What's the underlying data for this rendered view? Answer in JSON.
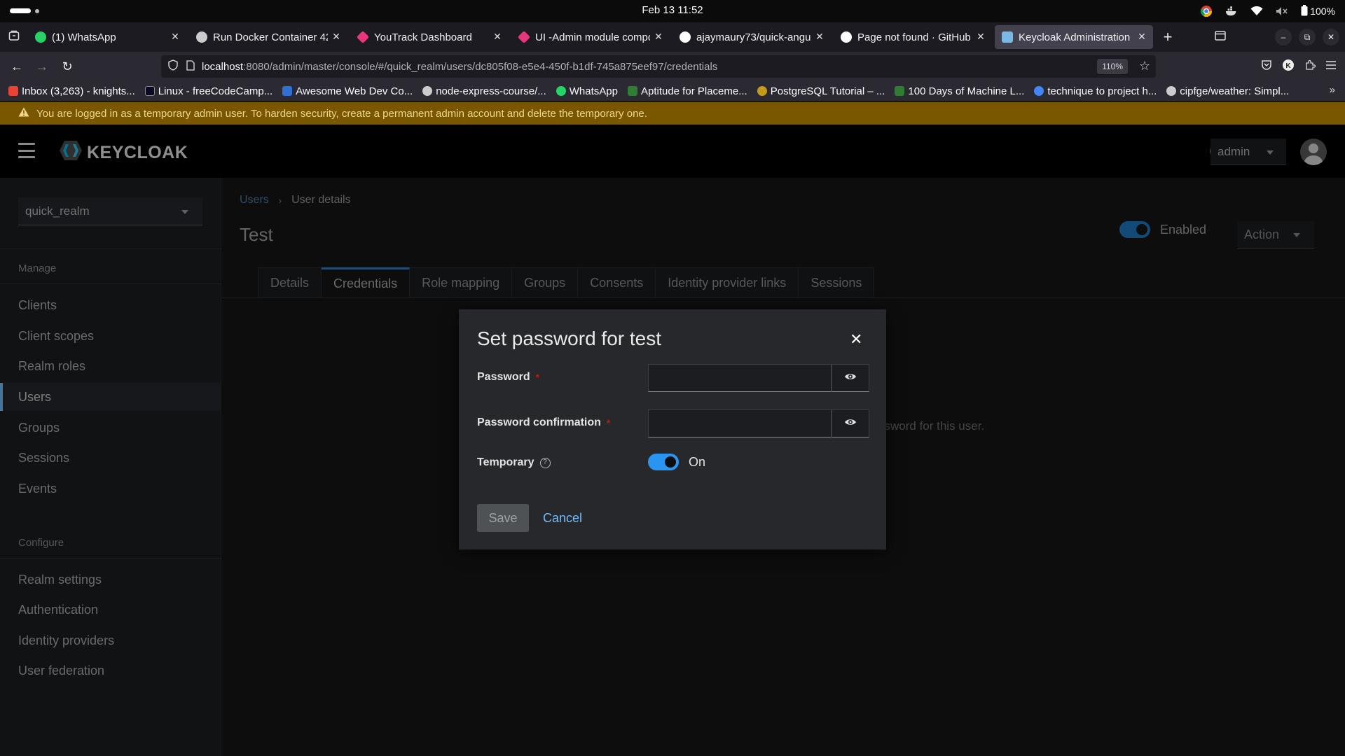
{
  "system": {
    "clock": "Feb 13  11:52",
    "battery": "100%"
  },
  "browser": {
    "tabs": [
      {
        "label": "(1) WhatsApp",
        "favicon_color": "#25d366"
      },
      {
        "label": "Run Docker Container 42",
        "favicon_color": "#cccccc"
      },
      {
        "label": "YouTrack Dashboard",
        "favicon_color": "#e8357e"
      },
      {
        "label": "UI -Admin module compo",
        "favicon_color": "#e8357e"
      },
      {
        "label": "ajaymaury73/quick-angul",
        "favicon_color": "#ffffff"
      },
      {
        "label": "Page not found · GitHub",
        "favicon_color": "#ffffff"
      },
      {
        "label": "Keycloak Administration",
        "favicon_color": "#7ab8e6"
      }
    ],
    "url_host": "localhost",
    "url_rest": ":8080/admin/master/console/#/quick_realm/users/dc805f08-e5e4-450f-b1df-745a875eef97/credentials",
    "zoom": "110%",
    "bookmarks": [
      {
        "label": "Inbox (3,263) - knights...",
        "color": "#ea4335"
      },
      {
        "label": "Linux - freeCodeCamp...",
        "color": "#0a0a23"
      },
      {
        "label": "Awesome Web Dev Co...",
        "color": "#2f6fd6"
      },
      {
        "label": "node-express-course/...",
        "color": "#cccccc"
      },
      {
        "label": "WhatsApp",
        "color": "#25d366"
      },
      {
        "label": "Aptitude for Placeme...",
        "color": "#2e7d32"
      },
      {
        "label": "PostgreSQL Tutorial – ...",
        "color": "#c49a1a"
      },
      {
        "label": "100 Days of Machine L...",
        "color": "#2e7d32"
      },
      {
        "label": "technique to project h...",
        "color": "#4285f4"
      },
      {
        "label": "cipfge/weather: Simpl...",
        "color": "#cccccc"
      }
    ]
  },
  "banner": {
    "text": "You are logged in as a temporary admin user. To harden security, create a permanent admin account and delete the temporary one."
  },
  "header": {
    "logo_text": "KEYCLOAK",
    "user": "admin"
  },
  "sidebar": {
    "realm": "quick_realm",
    "manage_label": "Manage",
    "manage_items": [
      "Clients",
      "Client scopes",
      "Realm roles",
      "Users",
      "Groups",
      "Sessions",
      "Events"
    ],
    "configure_label": "Configure",
    "configure_items": [
      "Realm settings",
      "Authentication",
      "Identity providers",
      "User federation"
    ]
  },
  "main": {
    "breadcrumb_link": "Users",
    "breadcrumb_current": "User details",
    "title": "Test",
    "enabled_label": "Enabled",
    "action_label": "Action",
    "tabs": [
      "Details",
      "Credentials",
      "Role mapping",
      "Groups",
      "Consents",
      "Identity provider links",
      "Sessions"
    ],
    "background_hint": "ssword for this user."
  },
  "modal": {
    "title": "Set password for test",
    "password_label": "Password",
    "password_value": "",
    "confirm_label": "Password confirmation",
    "confirm_value": "",
    "required_mark": "*",
    "temporary_label": "Temporary",
    "temporary_state": "On",
    "save_label": "Save",
    "cancel_label": "Cancel"
  }
}
